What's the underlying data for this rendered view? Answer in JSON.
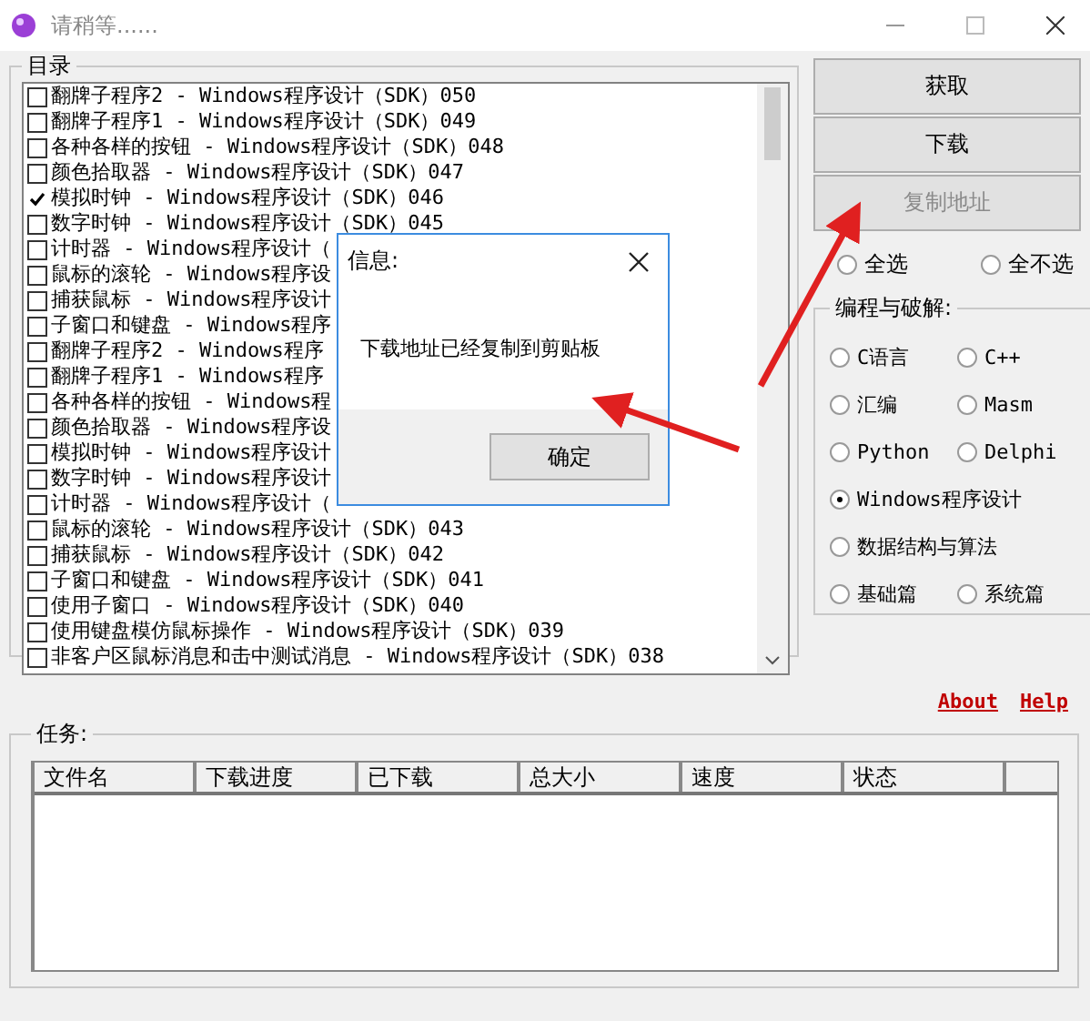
{
  "window": {
    "title": "请稍等......"
  },
  "catalog": {
    "label": "目录",
    "items": [
      {
        "text": "翻牌子程序2 - Windows程序设计（SDK）050",
        "checked": false
      },
      {
        "text": "翻牌子程序1 - Windows程序设计（SDK）049",
        "checked": false
      },
      {
        "text": "各种各样的按钮 - Windows程序设计（SDK）048",
        "checked": false
      },
      {
        "text": "颜色拾取器 - Windows程序设计（SDK）047",
        "checked": false
      },
      {
        "text": "模拟时钟 - Windows程序设计（SDK）046",
        "checked": true
      },
      {
        "text": "数字时钟 - Windows程序设计（SDK）045",
        "checked": false
      },
      {
        "text": "计时器 - Windows程序设计（",
        "checked": false
      },
      {
        "text": "鼠标的滚轮 - Windows程序设",
        "checked": false
      },
      {
        "text": "捕获鼠标 - Windows程序设计",
        "checked": false
      },
      {
        "text": "子窗口和键盘 - Windows程序",
        "checked": false
      },
      {
        "text": "翻牌子程序2 - Windows程序",
        "checked": false
      },
      {
        "text": "翻牌子程序1 - Windows程序",
        "checked": false
      },
      {
        "text": "各种各样的按钮 - Windows程",
        "checked": false
      },
      {
        "text": "颜色拾取器 - Windows程序设",
        "checked": false
      },
      {
        "text": "模拟时钟 - Windows程序设计",
        "checked": false
      },
      {
        "text": "数字时钟 - Windows程序设计",
        "checked": false
      },
      {
        "text": "计时器 - Windows程序设计（",
        "checked": false
      },
      {
        "text": "鼠标的滚轮 - Windows程序设计（SDK）043",
        "checked": false
      },
      {
        "text": "捕获鼠标 - Windows程序设计（SDK）042",
        "checked": false
      },
      {
        "text": "子窗口和键盘 - Windows程序设计（SDK）041",
        "checked": false
      },
      {
        "text": "使用子窗口 - Windows程序设计（SDK）040",
        "checked": false
      },
      {
        "text": "使用键盘模仿鼠标操作 - Windows程序设计（SDK）039",
        "checked": false
      },
      {
        "text": "非客户区鼠标消息和击中测试消息 - Windows程序设计（SDK）038",
        "checked": false
      }
    ]
  },
  "actions": [
    {
      "label": "获取",
      "disabled": false
    },
    {
      "label": "下载",
      "disabled": false
    },
    {
      "label": "复制地址",
      "disabled": true
    }
  ],
  "select_all": [
    {
      "label": "全选",
      "selected": false
    },
    {
      "label": "全不选",
      "selected": false
    }
  ],
  "category": {
    "label": "编程与破解:",
    "options": [
      {
        "label": "C语言",
        "selected": false
      },
      {
        "label": "C++",
        "selected": false
      },
      {
        "label": "汇编",
        "selected": false
      },
      {
        "label": "Masm",
        "selected": false
      },
      {
        "label": "Python",
        "selected": false
      },
      {
        "label": "Delphi",
        "selected": false
      },
      {
        "label": "Windows程序设计",
        "selected": true
      },
      {
        "label": "数据结构与算法",
        "selected": false
      },
      {
        "label": "基础篇",
        "selected": false
      },
      {
        "label": "系统篇",
        "selected": false
      }
    ]
  },
  "links": [
    "About",
    "Help"
  ],
  "tasks": {
    "label": "任务:",
    "columns": [
      "文件名",
      "下载进度",
      "已下载",
      "总大小",
      "速度",
      "状态"
    ]
  },
  "dialog": {
    "title": "信息:",
    "message": "下载地址已经复制到剪贴板",
    "button": "确定"
  }
}
